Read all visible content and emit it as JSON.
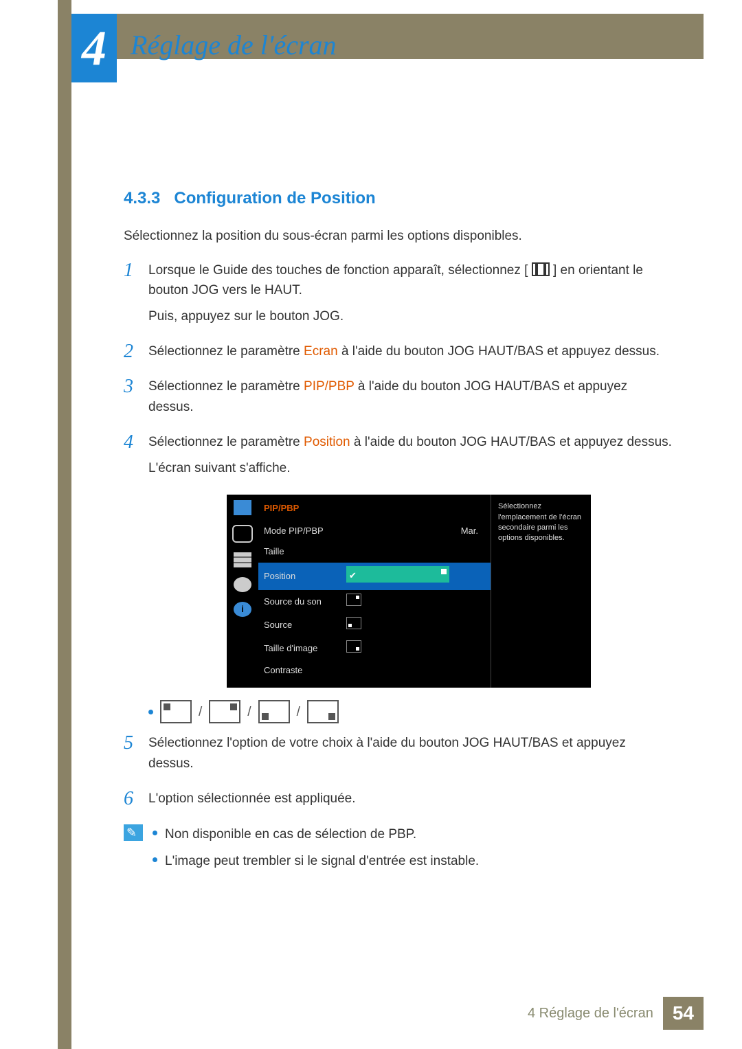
{
  "chapter": {
    "number": "4",
    "title": "Réglage de l'écran"
  },
  "section": {
    "number": "4.3.3",
    "title": "Configuration de Position"
  },
  "intro": "Sélectionnez la position du sous-écran parmi les options disponibles.",
  "steps": {
    "s1": {
      "n": "1",
      "a": "Lorsque le Guide des touches de fonction apparaît, sélectionnez [",
      "b": "] en orientant le bouton JOG vers le HAUT.",
      "c": "Puis, appuyez sur le bouton JOG."
    },
    "s2": {
      "n": "2",
      "pre": "Sélectionnez le paramètre ",
      "hl": "Ecran",
      "post": " à l'aide du bouton JOG HAUT/BAS et appuyez dessus."
    },
    "s3": {
      "n": "3",
      "pre": "Sélectionnez le paramètre ",
      "hl": "PIP/PBP",
      "post": " à l'aide du bouton JOG HAUT/BAS et appuyez dessus."
    },
    "s4": {
      "n": "4",
      "pre": "Sélectionnez le paramètre ",
      "hl": "Position",
      "post": " à l'aide du bouton JOG HAUT/BAS et appuyez dessus.",
      "after": "L'écran suivant s'affiche."
    },
    "s5": {
      "n": "5",
      "text": "Sélectionnez l'option de votre choix à l'aide du bouton JOG HAUT/BAS et appuyez dessus."
    },
    "s6": {
      "n": "6",
      "text": "L'option sélectionnée est appliquée."
    }
  },
  "osd": {
    "title": "PIP/PBP",
    "rows": {
      "mode": {
        "label": "Mode PIP/PBP",
        "val": "Mar."
      },
      "taille": {
        "label": "Taille"
      },
      "position": {
        "label": "Position"
      },
      "source_son": {
        "label": "Source du son"
      },
      "source": {
        "label": "Source"
      },
      "taille_img": {
        "label": "Taille d'image"
      },
      "contraste": {
        "label": "Contraste"
      }
    },
    "help": "Sélectionnez l'emplacement de l'écran secondaire parmi les options disponibles."
  },
  "notes": {
    "n1": "Non disponible en cas de sélection de PBP.",
    "n2": "L'image peut trembler si le signal d'entrée est instable."
  },
  "footer": {
    "chapter": "4 Réglage de l'écran",
    "page": "54"
  },
  "sep": "/"
}
